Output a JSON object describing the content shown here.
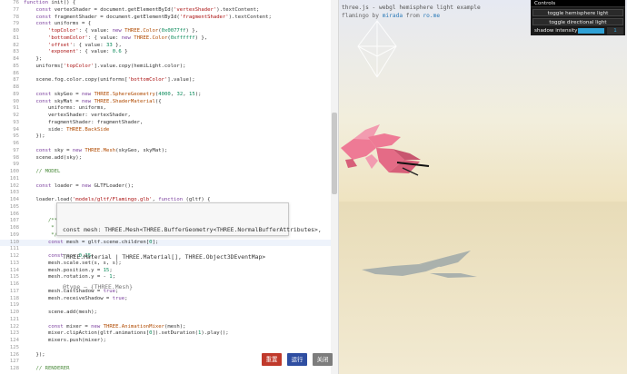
{
  "editor": {
    "lines": [
      {
        "num": "76",
        "code": "function init() {"
      },
      {
        "num": "77",
        "code": "    const vertexShader = document.getElementById('vertexShader').textContent;"
      },
      {
        "num": "78",
        "code": "    const fragmentShader = document.getElementById('fragmentShader').textContent;"
      },
      {
        "num": "79",
        "code": "    const uniforms = {"
      },
      {
        "num": "80",
        "code": "        'topColor': { value: new THREE.Color(0x0077ff) },"
      },
      {
        "num": "81",
        "code": "        'bottomColor': { value: new THREE.Color(0xffffff) },"
      },
      {
        "num": "82",
        "code": "        'offset': { value: 33 },"
      },
      {
        "num": "83",
        "code": "        'exponent': { value: 0.6 }"
      },
      {
        "num": "84",
        "code": "    };"
      },
      {
        "num": "85",
        "code": "    uniforms['topColor'].value.copy(hemiLight.color);"
      },
      {
        "num": "86",
        "code": ""
      },
      {
        "num": "87",
        "code": "    scene.fog.color.copy(uniforms['bottomColor'].value);"
      },
      {
        "num": "88",
        "code": ""
      },
      {
        "num": "89",
        "code": "    const skyGeo = new THREE.SphereGeometry(4000, 32, 15);"
      },
      {
        "num": "90",
        "code": "    const skyMat = new THREE.ShaderMaterial({"
      },
      {
        "num": "91",
        "code": "        uniforms: uniforms,"
      },
      {
        "num": "92",
        "code": "        vertexShader: vertexShader,"
      },
      {
        "num": "93",
        "code": "        fragmentShader: fragmentShader,"
      },
      {
        "num": "94",
        "code": "        side: THREE.BackSide"
      },
      {
        "num": "95",
        "code": "    });"
      },
      {
        "num": "96",
        "code": ""
      },
      {
        "num": "97",
        "code": "    const sky = new THREE.Mesh(skyGeo, skyMat);"
      },
      {
        "num": "98",
        "code": "    scene.add(sky);"
      },
      {
        "num": "99",
        "code": ""
      },
      {
        "num": "100",
        "code": "    // MODEL"
      },
      {
        "num": "101",
        "code": ""
      },
      {
        "num": "102",
        "code": "    const loader = new GLTFLoader();"
      },
      {
        "num": "103",
        "code": ""
      },
      {
        "num": "104",
        "code": "    loader.load('models/gltf/Flamingo.glb', function (gltf) {"
      },
      {
        "num": "105",
        "code": ""
      },
      {
        "num": "106",
        "code": ""
      },
      {
        "num": "107",
        "code": "        /**"
      },
      {
        "num": "108",
        "code": "         * @ty"
      },
      {
        "num": "109",
        "code": "         */"
      },
      {
        "num": "110",
        "code": "        const mesh = gltf.scene.children[0];"
      },
      {
        "num": "111",
        "code": ""
      },
      {
        "num": "112",
        "code": "        const s = 0.35;"
      },
      {
        "num": "113",
        "code": "        mesh.scale.set(s, s, s);"
      },
      {
        "num": "114",
        "code": "        mesh.position.y = 15;"
      },
      {
        "num": "115",
        "code": "        mesh.rotation.y = - 1;"
      },
      {
        "num": "116",
        "code": ""
      },
      {
        "num": "117",
        "code": "        mesh.castShadow = true;"
      },
      {
        "num": "118",
        "code": "        mesh.receiveShadow = true;"
      },
      {
        "num": "119",
        "code": ""
      },
      {
        "num": "120",
        "code": "        scene.add(mesh);"
      },
      {
        "num": "121",
        "code": ""
      },
      {
        "num": "122",
        "code": "        const mixer = new THREE.AnimationMixer(mesh);"
      },
      {
        "num": "123",
        "code": "        mixer.clipAction(gltf.animations[0]).setDuration(1).play();"
      },
      {
        "num": "124",
        "code": "        mixers.push(mixer);"
      },
      {
        "num": "125",
        "code": ""
      },
      {
        "num": "126",
        "code": "    });"
      },
      {
        "num": "127",
        "code": ""
      },
      {
        "num": "128",
        "code": "    // RENDERER"
      }
    ],
    "tooltip": {
      "code_line1": "const mesh: THREE.Mesh<THREE.BufferGeometry<THREE.NormalBufferAttributes>,",
      "code_line2": "THREE.Material | THREE.Material[], THREE.Object3DEventMap>",
      "doc": "@type — {THREE.Mesh}"
    },
    "buttons": {
      "reset": "重置",
      "run": "运行",
      "close": "关闭"
    }
  },
  "viewport": {
    "title": "three.js - webgl hemisphere light example",
    "subtitle_prefix": "flamingo by ",
    "subtitle_author": "mirada",
    "subtitle_mid": " from ",
    "subtitle_site": "ro.me",
    "gui": {
      "title": "Controls",
      "btn_hemi": "toggle hemisphere light",
      "btn_dir": "toggle directional light",
      "shadow_label": "shadow intensity",
      "shadow_value": "1",
      "shadow_level": 1
    }
  },
  "colors": {
    "flamingo": "#ee7a95",
    "flamingo_dark": "#c8566f",
    "reset_button": "#c0392b",
    "run_button": "#2f4ea1",
    "close_button": "#7d7d7d",
    "gui_accent": "#2fa1d6"
  }
}
